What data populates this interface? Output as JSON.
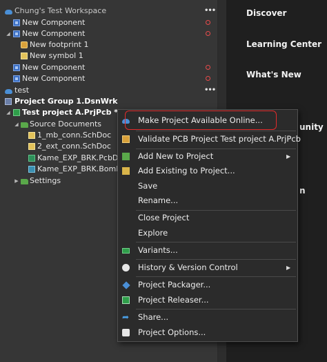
{
  "tree": {
    "workspace": {
      "label": "Chung's Test Workspace",
      "marker": "•••"
    },
    "items": [
      {
        "label": "New Component"
      },
      {
        "label": "New Component"
      },
      {
        "label": "New footprint 1"
      },
      {
        "label": "New symbol 1"
      },
      {
        "label": "New Component"
      },
      {
        "label": "New Component"
      }
    ],
    "test": {
      "label": "test",
      "marker": "•••"
    },
    "project_group": {
      "label": "Project Group 1.DsnWrk"
    },
    "project": {
      "label": "Test project A.PrjPcb *"
    },
    "source_documents": {
      "label": "Source Documents"
    },
    "documents": [
      {
        "label": "1_mb_conn.SchDoc"
      },
      {
        "label": "2_ext_conn.SchDoc"
      },
      {
        "label": "Kame_EXP_BRK.PcbDoc"
      },
      {
        "label": "Kame_EXP_BRK.BomDoc"
      }
    ],
    "settings": {
      "label": "Settings"
    }
  },
  "right_nav": {
    "discover": "Discover",
    "learning_center": "Learning Center",
    "whats_new": "What's New",
    "partial_community": "unity",
    "partial_n": "n"
  },
  "context_menu": {
    "items": [
      {
        "label": "Make Project Available Online...",
        "icon": "cloud-icon"
      },
      {
        "label": "Validate PCB Project Test project A.PrjPcb",
        "icon": "validate-icon"
      },
      {
        "label": "Add New to Project",
        "icon": "add-new-icon",
        "submenu": true
      },
      {
        "label": "Add Existing to Project...",
        "icon": "add-existing-icon"
      },
      {
        "label": "Save"
      },
      {
        "label": "Rename..."
      },
      {
        "label": "Close Project"
      },
      {
        "label": "Explore"
      },
      {
        "label": "Variants...",
        "icon": "variants-icon"
      },
      {
        "label": "History & Version Control",
        "icon": "history-icon",
        "submenu": true
      },
      {
        "label": "Project Packager...",
        "icon": "packager-icon"
      },
      {
        "label": "Project Releaser...",
        "icon": "releaser-icon"
      },
      {
        "label": "Share...",
        "icon": "share-icon"
      },
      {
        "label": "Project Options...",
        "icon": "options-icon"
      }
    ],
    "submenu_arrow": "▶",
    "share_glyph": "➦"
  },
  "colors": {
    "highlight_box": "#e32b2b",
    "unsaved_marker": "#e84b4b",
    "panel_bg": "#363636",
    "menu_bg": "#2b2b2b",
    "right_panel_bg": "#1f1f1f"
  }
}
